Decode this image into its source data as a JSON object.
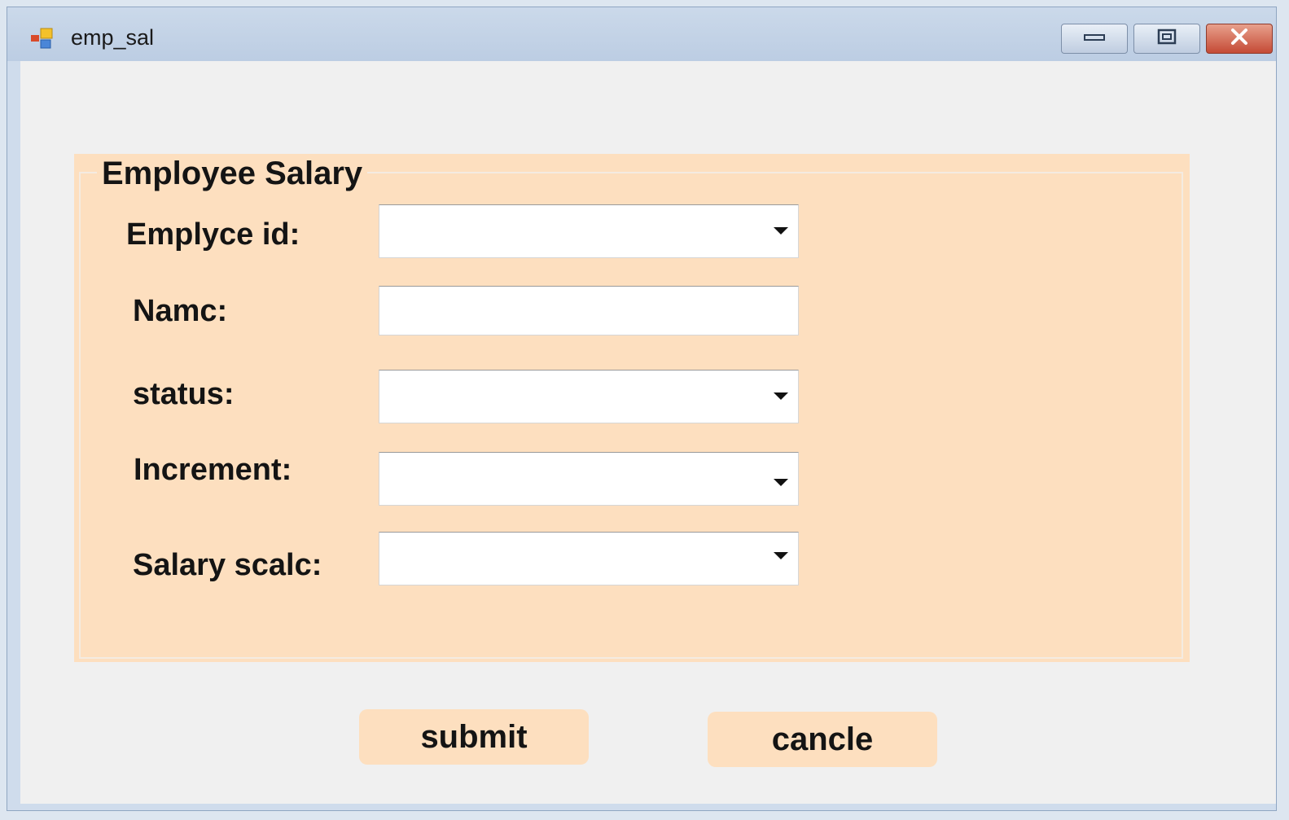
{
  "window": {
    "title": "emp_sal"
  },
  "group": {
    "legend": "Employee Salary"
  },
  "fields": {
    "employee_id": {
      "label": "Emplyce id:",
      "value": ""
    },
    "name": {
      "label": "Namc:",
      "value": ""
    },
    "status": {
      "label": "status:",
      "value": ""
    },
    "increment": {
      "label": "Increment:",
      "value": ""
    },
    "salary_scale": {
      "label": "Salary scalc:",
      "value": ""
    }
  },
  "buttons": {
    "submit": "submit",
    "cancel": "cancle"
  },
  "icons": {
    "app": "app-icon",
    "minimize": "minimize-icon",
    "maximize": "maximize-icon",
    "close": "close-icon",
    "dropdown": "chevron-down-icon"
  },
  "colors": {
    "group_background": "#fddfbf",
    "form_background": "#f0f0f0",
    "close_button": "#c54a35"
  }
}
